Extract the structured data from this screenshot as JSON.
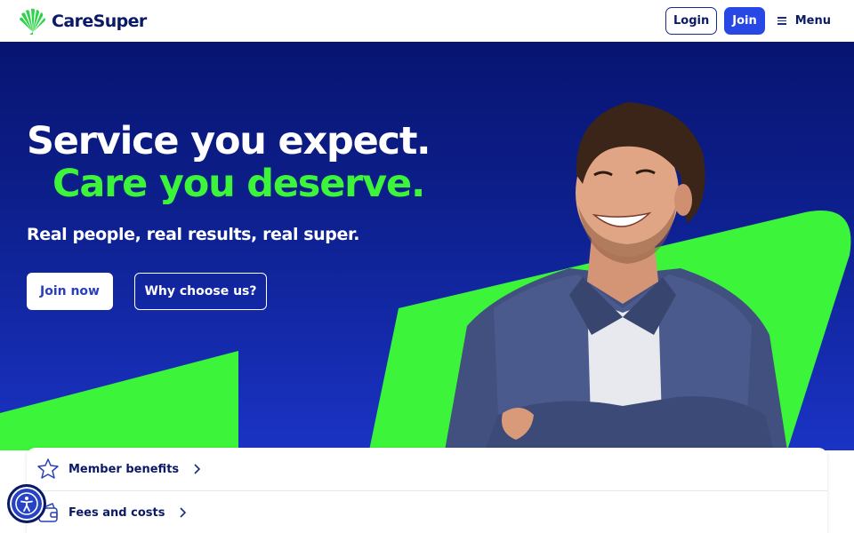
{
  "header": {
    "brand": "CareSuper",
    "login_label": "Login",
    "join_label": "Join",
    "menu_label": "Menu"
  },
  "hero": {
    "headline_line1": "Service you expect.",
    "headline_line2": "Care you deserve.",
    "subheadline": "Real people, real results, real super.",
    "primary_cta": "Join now",
    "secondary_cta": "Why choose us?"
  },
  "quick_links": [
    {
      "label": "Member benefits",
      "icon": "star-badge-icon"
    },
    {
      "label": "Fees and costs",
      "icon": "wallet-icon"
    }
  ],
  "accessibility": {
    "icon": "accessibility-icon"
  },
  "colors": {
    "navy": "#0b1a66",
    "hero_blue": "#0d1f8c",
    "accent_green": "#3cf53a",
    "join_blue": "#2848e6"
  }
}
